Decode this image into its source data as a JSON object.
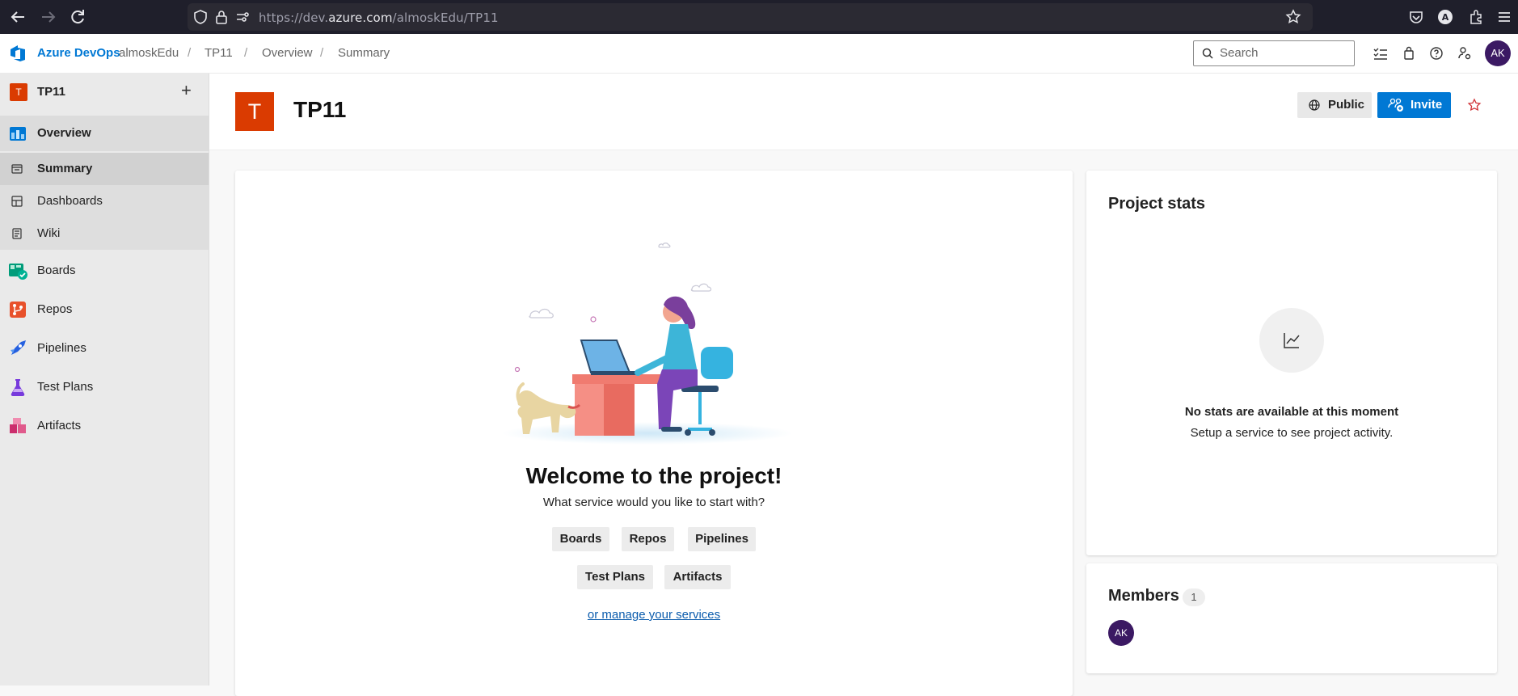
{
  "browser": {
    "url_prefix": "https://dev.",
    "url_host": "azure.com",
    "url_path": "/almoskEdu/TP11"
  },
  "header": {
    "brand": "Azure DevOps",
    "breadcrumbs": [
      "almoskEdu",
      "TP11",
      "Overview",
      "Summary"
    ],
    "search_placeholder": "Search",
    "avatar_initials": "AK"
  },
  "sidebar": {
    "project_badge": "T",
    "project_name": "TP11",
    "items": [
      {
        "label": "Overview",
        "icon": "overview-icon"
      },
      {
        "label": "Summary",
        "icon": "summary-icon"
      },
      {
        "label": "Dashboards",
        "icon": "dashboards-icon"
      },
      {
        "label": "Wiki",
        "icon": "wiki-icon"
      },
      {
        "label": "Boards",
        "icon": "boards-icon"
      },
      {
        "label": "Repos",
        "icon": "repos-icon"
      },
      {
        "label": "Pipelines",
        "icon": "pipelines-icon"
      },
      {
        "label": "Test Plans",
        "icon": "test-plans-icon"
      },
      {
        "label": "Artifacts",
        "icon": "artifacts-icon"
      }
    ]
  },
  "project": {
    "badge": "T",
    "title": "TP11",
    "public_label": "Public",
    "invite_label": "Invite"
  },
  "welcome": {
    "title": "Welcome to the project!",
    "subtitle": "What service would you like to start with?",
    "services": [
      "Boards",
      "Repos",
      "Pipelines",
      "Test Plans",
      "Artifacts"
    ],
    "manage_link": "or manage your services"
  },
  "stats": {
    "title": "Project stats",
    "empty_title": "No stats are available at this moment",
    "empty_subtitle": "Setup a service to see project activity."
  },
  "members": {
    "title": "Members",
    "count": "1",
    "avatar_initials": "AK"
  },
  "colors": {
    "accent": "#0078d4",
    "project_badge": "#da3b01",
    "avatar": "#3b1963"
  }
}
